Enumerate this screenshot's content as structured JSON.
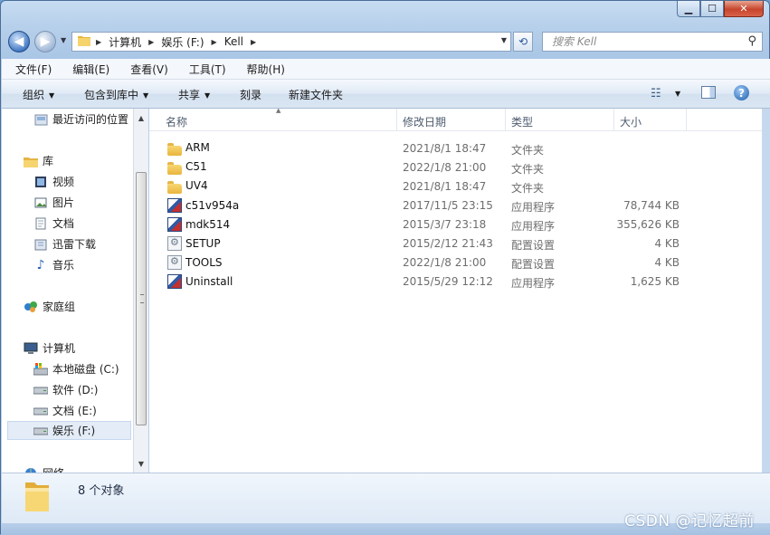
{
  "window": {
    "controls": [
      "minimize",
      "maximize",
      "close"
    ]
  },
  "address_bar": {
    "segments": [
      "计算机",
      "娱乐 (F:)",
      "Kell"
    ]
  },
  "search": {
    "placeholder": "搜索 Kell"
  },
  "menu": [
    "文件(F)",
    "编辑(E)",
    "查看(V)",
    "工具(T)",
    "帮助(H)"
  ],
  "toolbar": {
    "organize": "组织",
    "include_in_library": "包含到库中",
    "share": "共享",
    "burn": "刻录",
    "new_folder": "新建文件夹"
  },
  "nav_pane": {
    "recent": "最近访问的位置",
    "libraries": "库",
    "videos": "视频",
    "pictures": "图片",
    "documents": "文档",
    "thunder": "迅雷下载",
    "music": "音乐",
    "homegroup": "家庭组",
    "computer": "计算机",
    "drive_c": "本地磁盘 (C:)",
    "drive_d": "软件 (D:)",
    "drive_e": "文档 (E:)",
    "drive_f": "娱乐 (F:)",
    "network": "网络"
  },
  "columns": {
    "name": "名称",
    "date": "修改日期",
    "type": "类型",
    "size": "大小"
  },
  "files": [
    {
      "name": "ARM",
      "date": "2021/8/1 18:47",
      "type": "文件夹",
      "size": "",
      "icon": "folder-icon"
    },
    {
      "name": "C51",
      "date": "2022/1/8 21:00",
      "type": "文件夹",
      "size": "",
      "icon": "folder-icon"
    },
    {
      "name": "UV4",
      "date": "2021/8/1 18:47",
      "type": "文件夹",
      "size": "",
      "icon": "folder-icon"
    },
    {
      "name": "c51v954a",
      "date": "2017/11/5 23:15",
      "type": "应用程序",
      "size": "78,744 KB",
      "icon": "application-icon"
    },
    {
      "name": "mdk514",
      "date": "2015/3/7 23:18",
      "type": "应用程序",
      "size": "355,626 KB",
      "icon": "application-icon"
    },
    {
      "name": "SETUP",
      "date": "2015/2/12 21:43",
      "type": "配置设置",
      "size": "4 KB",
      "icon": "config-settings-icon"
    },
    {
      "name": "TOOLS",
      "date": "2022/1/8 21:00",
      "type": "配置设置",
      "size": "4 KB",
      "icon": "config-settings-icon"
    },
    {
      "name": "Uninstall",
      "date": "2015/5/29 12:12",
      "type": "应用程序",
      "size": "1,625 KB",
      "icon": "application-icon"
    }
  ],
  "details": {
    "count": "8 个对象"
  },
  "watermark": "CSDN @记忆超前"
}
